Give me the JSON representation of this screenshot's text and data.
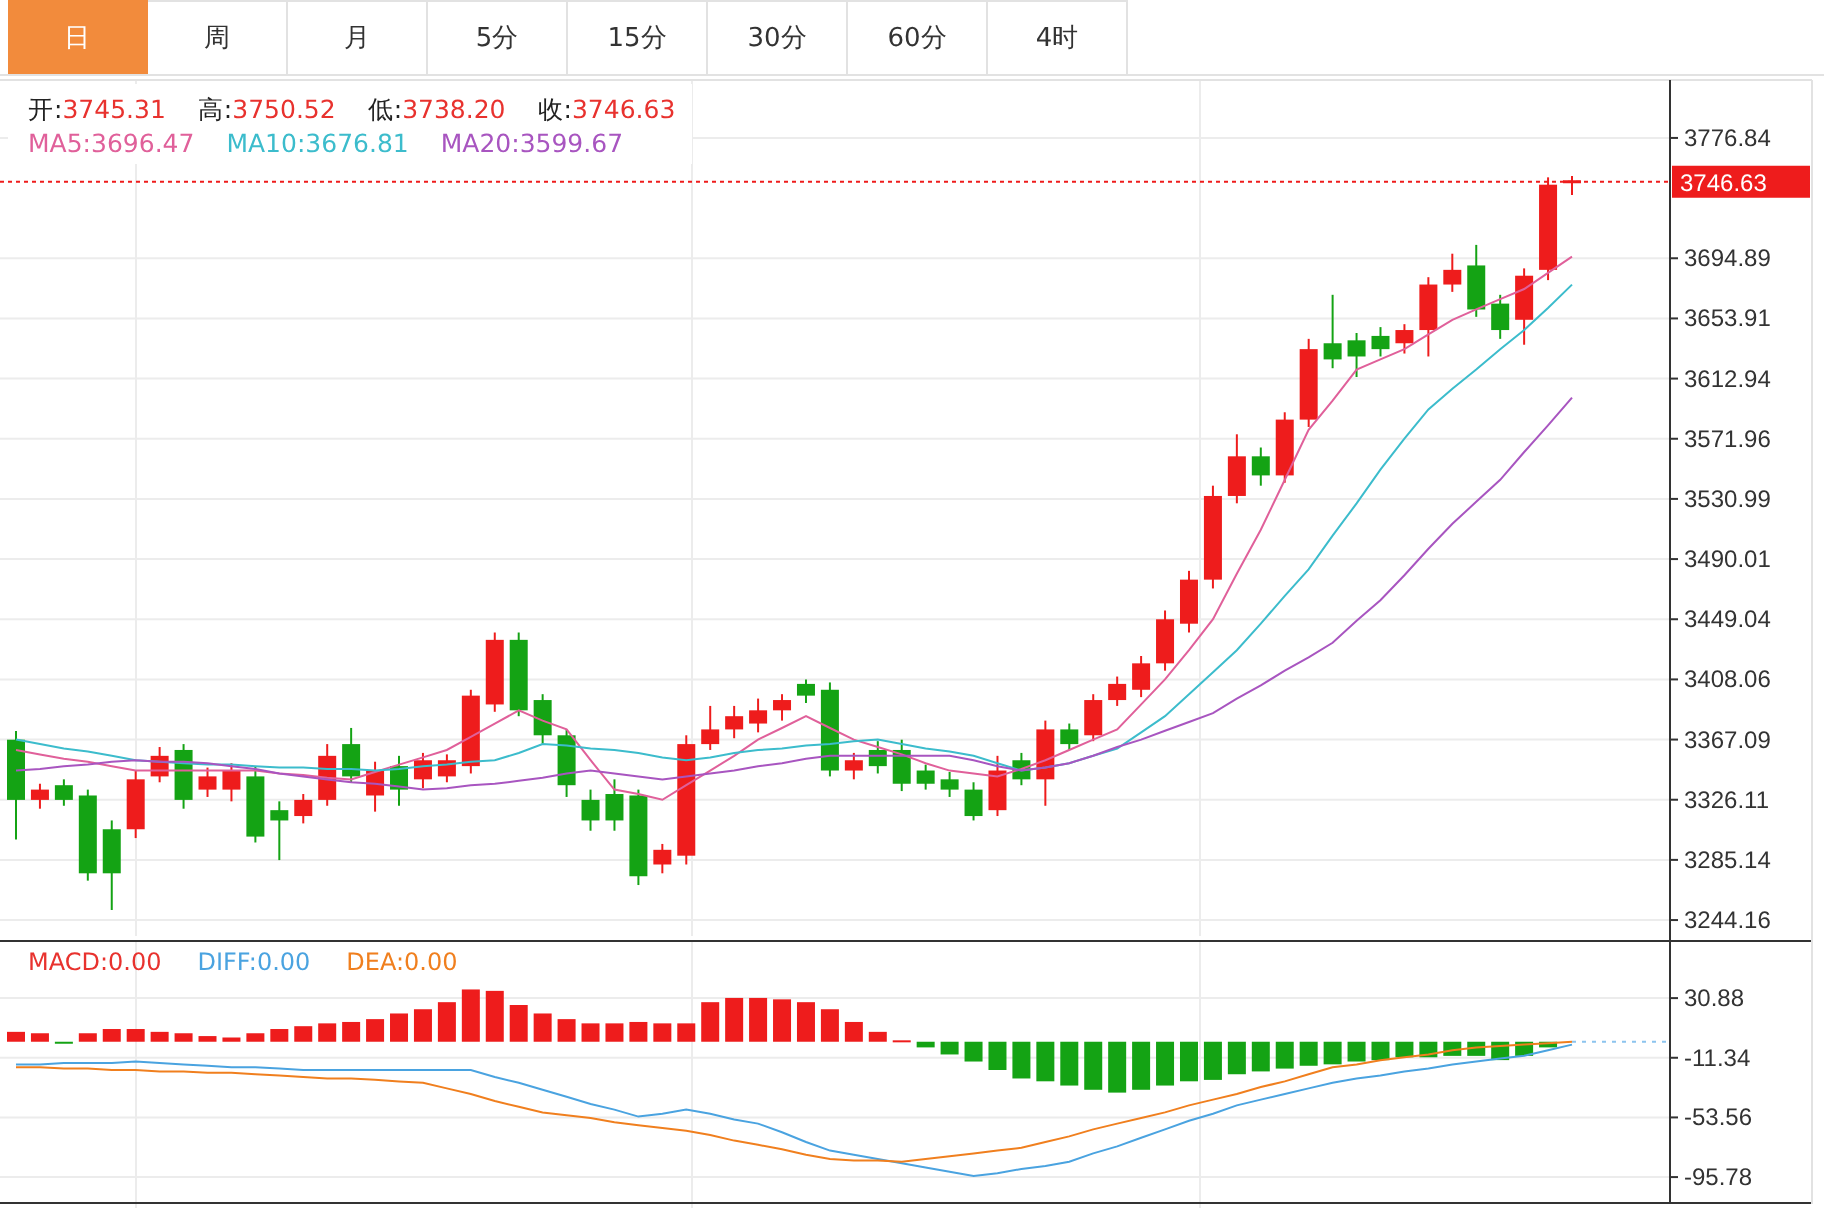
{
  "tabs": [
    {
      "label": "日",
      "selected": true
    },
    {
      "label": "周",
      "selected": false
    },
    {
      "label": "月",
      "selected": false
    },
    {
      "label": "5分",
      "selected": false
    },
    {
      "label": "15分",
      "selected": false
    },
    {
      "label": "30分",
      "selected": false
    },
    {
      "label": "60分",
      "selected": false
    },
    {
      "label": "4时",
      "selected": false
    }
  ],
  "ohlc_legend": [
    {
      "label": "开:",
      "value": "3745.31"
    },
    {
      "label": "高:",
      "value": "3750.52"
    },
    {
      "label": "低:",
      "value": "3738.20"
    },
    {
      "label": "收:",
      "value": "3746.63"
    }
  ],
  "ma_legend": [
    {
      "label": "MA5:",
      "value": "3696.47",
      "color": "#e0609a"
    },
    {
      "label": "MA10:",
      "value": "3676.81",
      "color": "#3cbccc"
    },
    {
      "label": "MA20:",
      "value": "3599.67",
      "color": "#a855c0"
    }
  ],
  "price_chart": {
    "chart_data": {
      "type": "candlestick",
      "grid": true,
      "ylim": [
        3233.3,
        3816.3
      ],
      "yticks": [
        3776.84,
        3694.89,
        3653.91,
        3612.94,
        3571.96,
        3530.99,
        3490.01,
        3449.04,
        3408.06,
        3367.09,
        3326.11,
        3285.14,
        3244.16
      ],
      "ohlc": [
        [
          3367,
          3373,
          3299,
          3326
        ],
        [
          3326,
          3337,
          3320,
          3333
        ],
        [
          3336,
          3340,
          3322,
          3326
        ],
        [
          3329,
          3333,
          3271,
          3276
        ],
        [
          3306,
          3312,
          3251,
          3276
        ],
        [
          3306,
          3346,
          3300,
          3340
        ],
        [
          3342,
          3362,
          3338,
          3356
        ],
        [
          3360,
          3364,
          3320,
          3326
        ],
        [
          3333,
          3348,
          3328,
          3342
        ],
        [
          3333,
          3351,
          3325,
          3346
        ],
        [
          3342,
          3349,
          3297,
          3301
        ],
        [
          3319,
          3325,
          3285,
          3312
        ],
        [
          3315,
          3330,
          3310,
          3326
        ],
        [
          3326,
          3364,
          3322,
          3356
        ],
        [
          3364,
          3375,
          3338,
          3342
        ],
        [
          3329,
          3352,
          3318,
          3346
        ],
        [
          3349,
          3356,
          3322,
          3333
        ],
        [
          3340,
          3358,
          3334,
          3353
        ],
        [
          3342,
          3357,
          3338,
          3353
        ],
        [
          3349,
          3401,
          3344,
          3397
        ],
        [
          3391,
          3440,
          3386,
          3435
        ],
        [
          3435,
          3440,
          3383,
          3387
        ],
        [
          3394,
          3398,
          3364,
          3370
        ],
        [
          3370,
          3374,
          3328,
          3336
        ],
        [
          3326,
          3333,
          3305,
          3312
        ],
        [
          3330,
          3340,
          3305,
          3312
        ],
        [
          3329,
          3333,
          3268,
          3274
        ],
        [
          3282,
          3296,
          3276,
          3292
        ],
        [
          3288,
          3370,
          3282,
          3364
        ],
        [
          3364,
          3390,
          3360,
          3374
        ],
        [
          3374,
          3390,
          3368,
          3383
        ],
        [
          3378,
          3395,
          3372,
          3387
        ],
        [
          3387,
          3398,
          3380,
          3394
        ],
        [
          3405,
          3408,
          3392,
          3397
        ],
        [
          3401,
          3406,
          3342,
          3346
        ],
        [
          3346,
          3358,
          3340,
          3353
        ],
        [
          3360,
          3366,
          3344,
          3349
        ],
        [
          3360,
          3367,
          3332,
          3337
        ],
        [
          3346,
          3350,
          3333,
          3337
        ],
        [
          3340,
          3345,
          3328,
          3333
        ],
        [
          3333,
          3338,
          3312,
          3315
        ],
        [
          3319,
          3356,
          3315,
          3346
        ],
        [
          3353,
          3358,
          3336,
          3340
        ],
        [
          3340,
          3380,
          3322,
          3374
        ],
        [
          3374,
          3378,
          3360,
          3364
        ],
        [
          3370,
          3398,
          3366,
          3394
        ],
        [
          3394,
          3410,
          3390,
          3405
        ],
        [
          3401,
          3424,
          3396,
          3419
        ],
        [
          3419,
          3455,
          3414,
          3449
        ],
        [
          3446,
          3482,
          3440,
          3476
        ],
        [
          3476,
          3540,
          3470,
          3533
        ],
        [
          3533,
          3575,
          3528,
          3560
        ],
        [
          3560,
          3566,
          3540,
          3547
        ],
        [
          3547,
          3590,
          3542,
          3585
        ],
        [
          3585,
          3640,
          3580,
          3633
        ],
        [
          3637,
          3670,
          3620,
          3626
        ],
        [
          3639,
          3644,
          3614,
          3628
        ],
        [
          3642,
          3648,
          3628,
          3633
        ],
        [
          3637,
          3650,
          3630,
          3646
        ],
        [
          3646,
          3682,
          3628,
          3677
        ],
        [
          3677,
          3698,
          3672,
          3687
        ],
        [
          3690,
          3704,
          3655,
          3660
        ],
        [
          3664,
          3670,
          3640,
          3646
        ],
        [
          3653,
          3688,
          3636,
          3683
        ],
        [
          3687,
          3750,
          3680,
          3745
        ],
        [
          3745,
          3751,
          3738,
          3747
        ]
      ],
      "series": [
        {
          "type": "line",
          "color": "#e0609a",
          "values": [
            3360,
            3357,
            3354,
            3352,
            3349,
            3346,
            3346,
            3346,
            3346,
            3346,
            3346,
            3344,
            3343,
            3341,
            3340,
            3345,
            3350,
            3355,
            3360,
            3369,
            3378,
            3387,
            3380,
            3374,
            3353,
            3333,
            3330,
            3326,
            3336,
            3346,
            3356,
            3367,
            3375,
            3383,
            3375,
            3367,
            3362,
            3357,
            3351,
            3346,
            3344,
            3342,
            3347,
            3353,
            3360,
            3367,
            3374,
            3391,
            3408,
            3428,
            3449,
            3480,
            3510,
            3544,
            3578,
            3598,
            3619,
            3626,
            3633,
            3643,
            3653,
            3660,
            3667,
            3674,
            3685,
            3696
          ]
        },
        {
          "type": "line",
          "color": "#3cbccc",
          "values": [
            3367,
            3364,
            3361,
            3359,
            3356,
            3353,
            3352,
            3351,
            3350,
            3350,
            3349,
            3348,
            3348,
            3347,
            3347,
            3346,
            3347,
            3349,
            3350,
            3352,
            3353,
            3358,
            3364,
            3363,
            3361,
            3360,
            3358,
            3355,
            3353,
            3355,
            3358,
            3360,
            3361,
            3363,
            3364,
            3366,
            3367,
            3364,
            3361,
            3359,
            3356,
            3351,
            3346,
            3348,
            3351,
            3356,
            3361,
            3372,
            3383,
            3398,
            3413,
            3428,
            3446,
            3465,
            3483,
            3506,
            3528,
            3551,
            3572,
            3592,
            3606,
            3619,
            3633,
            3646,
            3661,
            3677
          ]
        },
        {
          "type": "line",
          "color": "#a855c0",
          "values": [
            3346,
            3347,
            3349,
            3350,
            3352,
            3353,
            3352,
            3352,
            3351,
            3349,
            3347,
            3344,
            3342,
            3340,
            3338,
            3337,
            3335,
            3333,
            3334,
            3336,
            3337,
            3339,
            3341,
            3344,
            3346,
            3344,
            3342,
            3340,
            3342,
            3344,
            3346,
            3349,
            3351,
            3354,
            3356,
            3356,
            3356,
            3356,
            3356,
            3356,
            3353,
            3349,
            3346,
            3348,
            3351,
            3356,
            3362,
            3367,
            3373,
            3379,
            3385,
            3395,
            3404,
            3414,
            3423,
            3433,
            3448,
            3462,
            3479,
            3497,
            3514,
            3529,
            3544,
            3563,
            3581,
            3600
          ]
        }
      ]
    }
  },
  "macd_legend": [
    {
      "label": "MACD:",
      "value": "0.00",
      "color": "#e8322e"
    },
    {
      "label": "DIFF:",
      "value": "0.00",
      "color": "#4aa3e0"
    },
    {
      "label": "DEA:",
      "value": "0.00",
      "color": "#f07f1e"
    }
  ],
  "macd_chart": {
    "chart_data": {
      "type": "bar",
      "grid": true,
      "ylim": [
        -112,
        72
      ],
      "yticks": [
        30.88,
        -11.34,
        -53.56,
        -95.78
      ],
      "series": [
        {
          "color": "#ee1c1c",
          "values": [
            7,
            6,
            null,
            6,
            9,
            9,
            7,
            6,
            4,
            3,
            6,
            9,
            11,
            13,
            14,
            16,
            20,
            23,
            28,
            37,
            36,
            26,
            20,
            16,
            13,
            13,
            14,
            13,
            13,
            28,
            31,
            31,
            30,
            28,
            23,
            14,
            7,
            1,
            null,
            null,
            null,
            null,
            null,
            null,
            null,
            null,
            null,
            null,
            null,
            null,
            null,
            null,
            null,
            null,
            null,
            null,
            null,
            null,
            null,
            null,
            null,
            null,
            null,
            null,
            null,
            null
          ]
        },
        {
          "color": "#14a314",
          "values": [
            null,
            null,
            -1,
            null,
            null,
            null,
            null,
            null,
            null,
            null,
            null,
            null,
            null,
            null,
            null,
            null,
            null,
            null,
            null,
            null,
            null,
            null,
            null,
            null,
            null,
            null,
            null,
            null,
            null,
            null,
            null,
            null,
            null,
            null,
            null,
            null,
            null,
            null,
            -4,
            -9,
            -14,
            -20,
            -26,
            -28,
            -31,
            -34,
            -36,
            -34,
            -31,
            -28,
            -27,
            -23,
            -21,
            -19,
            -17,
            -16,
            -14,
            -13,
            -11,
            -11,
            -10,
            -10,
            -13,
            -10,
            -4,
            null
          ]
        },
        {
          "type": "line",
          "color": "#4aa3e0",
          "values": [
            -16,
            -16,
            -15,
            -15,
            -15,
            -14,
            -15,
            -16,
            -17,
            -18,
            -18,
            -19,
            -20,
            -20,
            -20,
            -20,
            -20,
            -20,
            -20,
            -20,
            -25,
            -29,
            -34,
            -39,
            -44,
            -48,
            -53,
            -51,
            -48,
            -51,
            -55,
            -58,
            -64,
            -71,
            -77,
            -80,
            -83,
            -86,
            -89,
            -92,
            -95,
            -93,
            -90,
            -88,
            -85,
            -79,
            -74,
            -68,
            -62,
            -56,
            -51,
            -45,
            -41,
            -37,
            -33,
            -29,
            -26,
            -24,
            -21,
            -19,
            -16,
            -14,
            -12,
            -10,
            -6,
            -2
          ]
        },
        {
          "type": "line",
          "color": "#f07f1e",
          "values": [
            -18,
            -18,
            -19,
            -19,
            -20,
            -20,
            -21,
            -21,
            -22,
            -22,
            -23,
            -24,
            -25,
            -26,
            -26,
            -27,
            -28,
            -29,
            -33,
            -37,
            -42,
            -46,
            -50,
            -52,
            -54,
            -57,
            -59,
            -61,
            -63,
            -66,
            -70,
            -73,
            -76,
            -80,
            -83,
            -84,
            -84,
            -85,
            -83,
            -81,
            -79,
            -77,
            -75,
            -71,
            -67,
            -62,
            -58,
            -54,
            -50,
            -45,
            -41,
            -37,
            -32,
            -28,
            -23,
            -18,
            -16,
            -13,
            -11,
            -9,
            -6,
            -4,
            -3,
            -2,
            -1,
            0
          ]
        }
      ]
    }
  },
  "last_price": "3746.63"
}
